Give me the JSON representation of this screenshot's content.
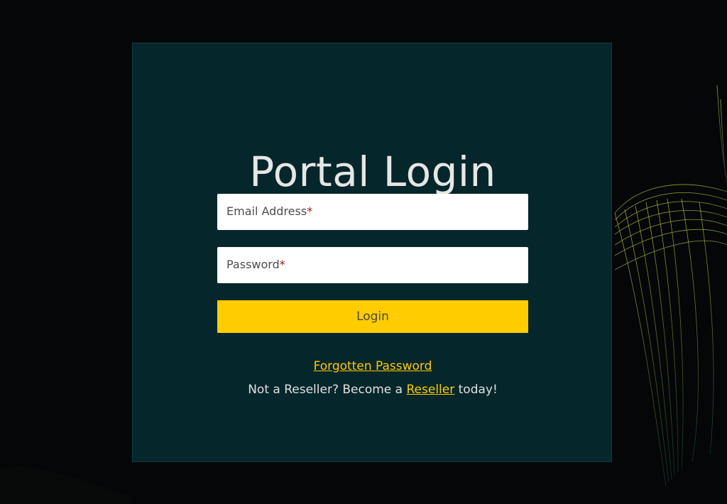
{
  "login": {
    "title": "Portal Login",
    "email_label": "Email Address",
    "password_label": "Password",
    "required_marker": "*",
    "login_button": "Login",
    "forgot_link": "Forgotten Password",
    "reseller_prefix": "Not a Reseller? Become a ",
    "reseller_link": "Reseller",
    "reseller_suffix": " today!"
  },
  "colors": {
    "background": "#050607",
    "card": "#05262b",
    "accent": "#ffcc00",
    "required": "#a01818",
    "title": "#e6e6e6"
  }
}
